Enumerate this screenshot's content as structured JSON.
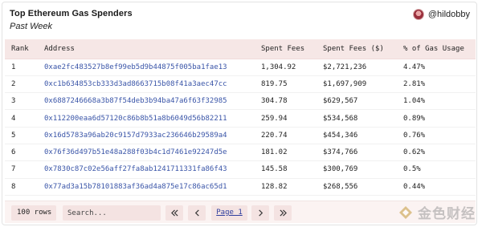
{
  "header": {
    "title": "Top Ethereum Gas Spenders",
    "subtitle": "Past Week",
    "author": "@hildobby",
    "avatar_icon": "avatar-icon"
  },
  "table": {
    "columns": [
      "Rank",
      "Address",
      "Spent Fees",
      "Spent Fees ($)",
      "% of Gas Usage"
    ],
    "rows": [
      {
        "rank": "1",
        "address": "0xae2fc483527b8ef99eb5d9b44875f005ba1fae13",
        "fees": "1,304.92",
        "usd": "$2,721,236",
        "pct": "4.47%"
      },
      {
        "rank": "2",
        "address": "0xc1b634853cb333d3ad8663715b08f41a3aec47cc",
        "fees": "819.75",
        "usd": "$1,697,909",
        "pct": "2.81%"
      },
      {
        "rank": "3",
        "address": "0x6887246668a3b87f54deb3b94ba47a6f63f32985",
        "fees": "304.78",
        "usd": "$629,567",
        "pct": "1.04%"
      },
      {
        "rank": "4",
        "address": "0x112200eaa6d57120c86b8b51a8b6049d56b82211",
        "fees": "259.94",
        "usd": "$534,568",
        "pct": "0.89%"
      },
      {
        "rank": "5",
        "address": "0x16d5783a96ab20c9157d7933ac236646b29589a4",
        "fees": "220.74",
        "usd": "$454,346",
        "pct": "0.76%"
      },
      {
        "rank": "6",
        "address": "0x76f36d497b51e48a288f03b4c1d7461e92247d5e",
        "fees": "181.02",
        "usd": "$374,766",
        "pct": "0.62%"
      },
      {
        "rank": "7",
        "address": "0x7830c87c02e56aff27fa8ab1241711331fa86f43",
        "fees": "145.58",
        "usd": "$300,769",
        "pct": "0.5%"
      },
      {
        "rank": "8",
        "address": "0x77ad3a15b78101883af36ad4a875e17c86ac65d1",
        "fees": "128.82",
        "usd": "$268,556",
        "pct": "0.44%"
      }
    ]
  },
  "footer": {
    "rows_per_page": "100 rows",
    "search_placeholder": "Search...",
    "page_label": "Page 1"
  },
  "watermark": {
    "text": "金色财经"
  },
  "colors": {
    "header_bg": "#f6e7e6",
    "control_bg": "#f4e3e2",
    "link": "#3a55a8",
    "watermark": "#9a9a9a"
  }
}
